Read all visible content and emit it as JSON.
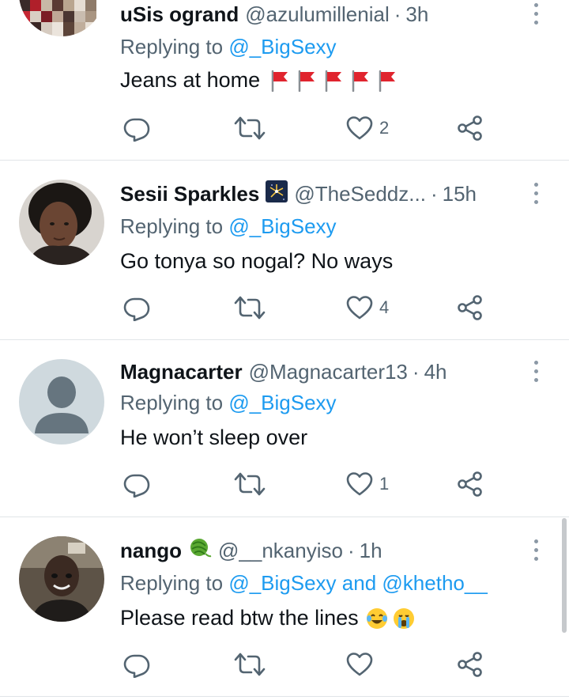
{
  "colors": {
    "link": "#1d9bf0",
    "muted": "#536471",
    "text": "#0f1419",
    "divider": "#e1e5e8"
  },
  "tweets": [
    {
      "name": "uSis ogrand",
      "handle": "@azulumillenial",
      "separator": "·",
      "time": "3h",
      "replying_prefix": "Replying to",
      "mention": "@_BigSexy",
      "text": "Jeans at home",
      "trailing_emoji": [
        "red-flag",
        "red-flag",
        "red-flag",
        "red-flag",
        "red-flag"
      ],
      "like_count": "2",
      "avatar": "pixelated-avatar"
    },
    {
      "name": "Sesii Sparkles",
      "handle": "@TheSeddz...",
      "separator": "·",
      "time": "15h",
      "replying_prefix": "Replying to",
      "mention": "@_BigSexy",
      "text": "Go tonya so nogal? No ways",
      "badge_emoji": "fireworks-emoji",
      "like_count": "4",
      "avatar": "photo-avatar"
    },
    {
      "name": "Magnacarter",
      "handle": "@Magnacarter13",
      "separator": "·",
      "time": "4h",
      "replying_prefix": "Replying to",
      "mention": "@_BigSexy",
      "text": "He won’t sleep over",
      "like_count": "1",
      "avatar": "default-avatar"
    },
    {
      "name": "nango",
      "handle": "@__nkanyiso",
      "separator": "·",
      "time": "1h",
      "replying_prefix": "Replying to",
      "mention": "@_BigSexy",
      "conjunction": "and",
      "mention2": "@khetho__",
      "text": "Please read btw the lines",
      "badge_emoji": "yarn-ball-emoji",
      "trailing_emoji": [
        "tears-of-joy-emoji",
        "crying-emoji"
      ],
      "like_count": "",
      "avatar": "photo-avatar"
    }
  ],
  "icons": {
    "reply": "reply-icon",
    "retweet": "retweet-icon",
    "like": "heart-icon",
    "share": "share-icon",
    "more": "more-vertical-icon"
  }
}
